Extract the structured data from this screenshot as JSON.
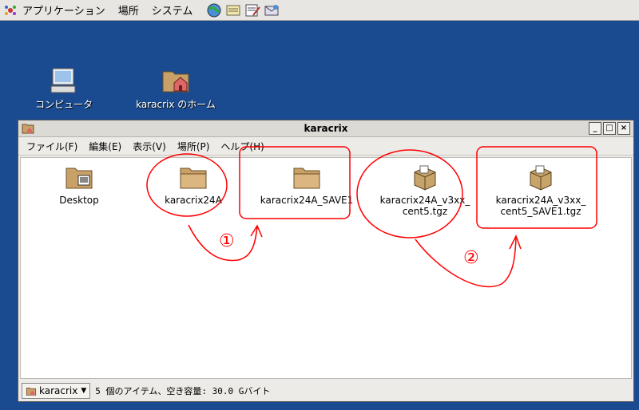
{
  "panel": {
    "menus": [
      "アプリケーション",
      "場所",
      "システム"
    ],
    "launchers": [
      "globe-launcher-icon",
      "notes-launcher-icon",
      "text-editor-launcher-icon",
      "mail-launcher-icon"
    ]
  },
  "desktop": {
    "computer_label": "コンピュータ",
    "home_label": "karacrix のホーム"
  },
  "window": {
    "title": "karacrix",
    "menus": [
      "ファイル(F)",
      "編集(E)",
      "表示(V)",
      "場所(P)",
      "ヘルプ(H)"
    ],
    "files": [
      {
        "name": "Desktop",
        "icon": "desktop-folder-icon"
      },
      {
        "name": "karacrix24A",
        "icon": "folder-icon"
      },
      {
        "name": "karacrix24A_SAVE1",
        "icon": "folder-icon"
      },
      {
        "name": "karacrix24A_v3xx_cent5.tgz",
        "line1": "karacrix24A_v3xx_",
        "line2": "cent5.tgz",
        "icon": "package-icon"
      },
      {
        "name": "karacrix24A_v3xx_cent5_SAVE1.tgz",
        "line1": "karacrix24A_v3xx_",
        "line2": "cent5_SAVE1.tgz",
        "icon": "package-icon"
      }
    ],
    "location": "karacrix",
    "status": "5 個のアイテム、空き容量: 30.0 Gバイト"
  },
  "annotations": {
    "step1": "①",
    "step2": "②",
    "color": "#ff0000"
  }
}
